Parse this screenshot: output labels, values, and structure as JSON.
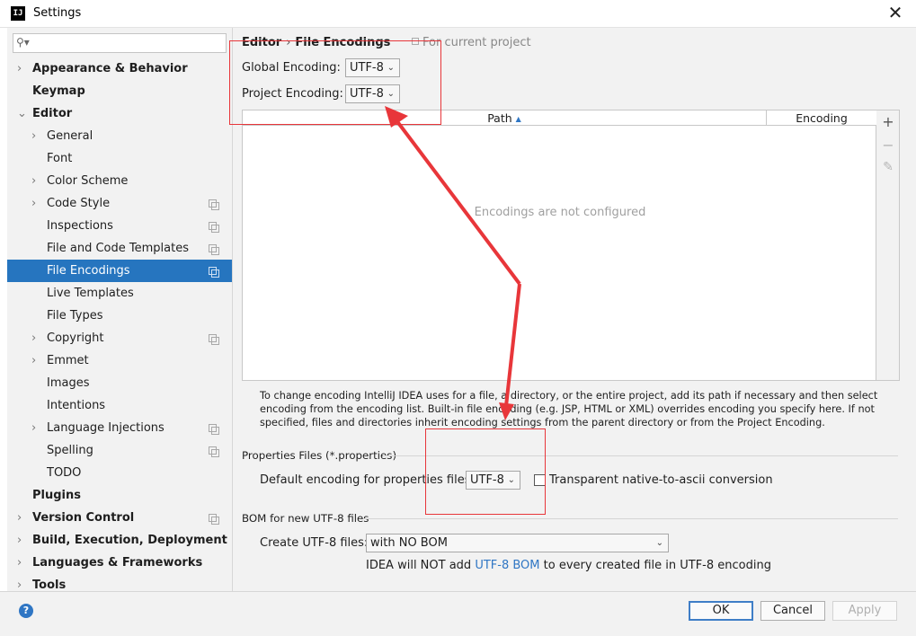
{
  "window": {
    "app_icon_text": "IJ",
    "title": "Settings",
    "close_glyph": "✕"
  },
  "sidebar": {
    "search_placeholder": "",
    "items": [
      {
        "label": "Appearance & Behavior",
        "bold": true,
        "arrow": "›",
        "copy": false
      },
      {
        "label": "Keymap",
        "bold": true,
        "arrow": "",
        "copy": false
      },
      {
        "label": "Editor",
        "bold": true,
        "arrow": "⌄",
        "copy": false
      },
      {
        "label": "General",
        "bold": false,
        "arrow": "›",
        "copy": false
      },
      {
        "label": "Font",
        "bold": false,
        "arrow": "",
        "copy": false
      },
      {
        "label": "Color Scheme",
        "bold": false,
        "arrow": "›",
        "copy": false
      },
      {
        "label": "Code Style",
        "bold": false,
        "arrow": "›",
        "copy": true
      },
      {
        "label": "Inspections",
        "bold": false,
        "arrow": "",
        "copy": true
      },
      {
        "label": "File and Code Templates",
        "bold": false,
        "arrow": "",
        "copy": true
      },
      {
        "label": "File Encodings",
        "bold": false,
        "arrow": "",
        "copy": true,
        "selected": true
      },
      {
        "label": "Live Templates",
        "bold": false,
        "arrow": "",
        "copy": false
      },
      {
        "label": "File Types",
        "bold": false,
        "arrow": "",
        "copy": false
      },
      {
        "label": "Copyright",
        "bold": false,
        "arrow": "›",
        "copy": true
      },
      {
        "label": "Emmet",
        "bold": false,
        "arrow": "›",
        "copy": false
      },
      {
        "label": "Images",
        "bold": false,
        "arrow": "",
        "copy": false
      },
      {
        "label": "Intentions",
        "bold": false,
        "arrow": "",
        "copy": false
      },
      {
        "label": "Language Injections",
        "bold": false,
        "arrow": "›",
        "copy": true
      },
      {
        "label": "Spelling",
        "bold": false,
        "arrow": "",
        "copy": true
      },
      {
        "label": "TODO",
        "bold": false,
        "arrow": "",
        "copy": false
      },
      {
        "label": "Plugins",
        "bold": true,
        "arrow": "",
        "copy": false
      },
      {
        "label": "Version Control",
        "bold": true,
        "arrow": "›",
        "copy": true
      },
      {
        "label": "Build, Execution, Deployment",
        "bold": true,
        "arrow": "›",
        "copy": false
      },
      {
        "label": "Languages & Frameworks",
        "bold": true,
        "arrow": "›",
        "copy": false
      },
      {
        "label": "Tools",
        "bold": true,
        "arrow": "›",
        "copy": false
      }
    ]
  },
  "main": {
    "breadcrumb": {
      "parent": "Editor",
      "separator": "›",
      "current": "File Encodings"
    },
    "scope_note": "For current project",
    "global_encoding": {
      "label": "Global Encoding:",
      "value": "UTF-8"
    },
    "project_encoding": {
      "label": "Project Encoding:",
      "value": "UTF-8"
    },
    "table": {
      "columns": [
        "Path",
        "Encoding"
      ],
      "sort_glyph": "▲",
      "empty_message": "Encodings are not configured",
      "tools": {
        "add": "+",
        "remove": "−",
        "edit": "✎"
      }
    },
    "hint": "To change encoding IntelliJ IDEA uses for a file, a directory, or the entire project, add its path if necessary and then select encoding from the encoding list. Built-in file encoding (e.g. JSP, HTML or XML) overrides encoding you specify here. If not specified, files and directories inherit encoding settings from the parent directory or from the Project Encoding.",
    "properties_section": {
      "title": "Properties Files (*.properties)",
      "default_label": "Default encoding for properties files:",
      "default_value": "UTF-8",
      "transparent_label": "Transparent native-to-ascii conversion",
      "transparent_checked": false
    },
    "bom_section": {
      "title": "BOM for new UTF-8 files",
      "create_label": "Create UTF-8 files:",
      "create_value": "with NO BOM",
      "note_prefix": "IDEA will NOT add ",
      "note_link": "UTF-8 BOM",
      "note_suffix": " to every created file in UTF-8 encoding"
    }
  },
  "footer": {
    "help": "?",
    "ok": "OK",
    "cancel": "Cancel",
    "apply": "Apply"
  },
  "colors": {
    "selection": "#2675bf",
    "annotation": "#e8363a",
    "link": "#2f76c4"
  }
}
